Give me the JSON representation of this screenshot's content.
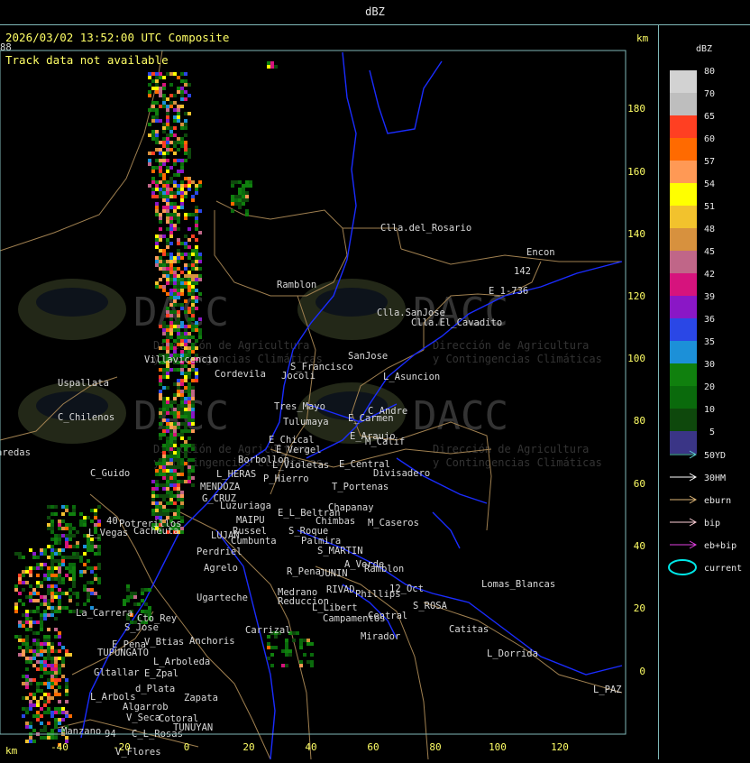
{
  "window": {
    "title": "dBZ"
  },
  "header": {
    "timestamp": "2026/03/02 13:52:00 UTC Composite",
    "status": "Track data not available",
    "unit_top": "km",
    "unit_bottom": "km"
  },
  "axes": {
    "x_ticks": [
      "-40",
      "-20",
      "0",
      "20",
      "40",
      "60",
      "80",
      "100",
      "120"
    ],
    "y_ticks": [
      "180",
      "160",
      "140",
      "120",
      "100",
      "80",
      "60",
      "40",
      "20",
      "0"
    ]
  },
  "watermarks": [
    {
      "logo": "DACC",
      "line1": "Dirección de Agricultura",
      "line2": "y Contingencias Climáticas"
    },
    {
      "logo": "DACC",
      "line1": "Dirección de Agricultura",
      "line2": "y Contingencias Climáticas"
    },
    {
      "logo": "DACC",
      "line1": "Dirección de Agricultura",
      "line2": "y Contingencias Climáticas"
    },
    {
      "logo": "DACC",
      "line1": "Dirección de Agricultura",
      "line2": "y Contingencias Climáticas"
    }
  ],
  "places": [
    "Clla.del_Rosario",
    "Encon",
    "142",
    "E_1-736",
    "Ramblon",
    "Clla.SanJose",
    "Clla.El_Cavadito",
    "S_Francisco",
    "SanJose",
    "Uspallata",
    "Villavicencio",
    "Cordevila",
    "L_Asuncion",
    "Jocoli",
    "Tres_Mayo",
    "E_Carmen",
    "C_Andre",
    "C_Chilenos",
    "Tulumaya",
    "E_Araujo",
    "M_Calif",
    "E_Chical",
    "E_Vergel",
    "Borbollon",
    "L_Violetas",
    "E_Central",
    "Divisadero",
    "aredas",
    "C_Guido",
    "L_HERAS",
    "P_Hierro",
    "T_Portenas",
    "MENDOZA",
    "G_CRUZ",
    "Luzuriaga",
    "E_L_Beltran",
    "Chapanay",
    "Potrerillos",
    "L_Vegas",
    "Cacheuta",
    "MAIPU",
    "Russel",
    "Chimbas",
    "M_Caseros",
    "LUJAN",
    "S_Roque",
    "Palmira",
    "Perdriel",
    "Cumbunta",
    "S_MARTIN",
    "Agrelo",
    "R_Pena",
    "JUNIN",
    "A_Verde",
    "Ramblon",
    "Ugarteche",
    "Medrano",
    "RIVAD",
    "Phillips",
    "12_Oct",
    "Lomas_Blancas",
    "Reduccion",
    "L_Libert",
    "S_ROSA",
    "La_Carrera",
    "Cto_Rey",
    "Campamentos",
    "Central",
    "S_Jose",
    "Carrizal",
    "Catitas",
    "E_Pena",
    "V_Btias",
    "Anchoris",
    "Mirador",
    "TUPUNGATO",
    "L_Dorrida",
    "L_Arboleda",
    "Gltallar",
    "E_Zpal",
    "d_Plata",
    "L_PAZ",
    "L_Arbols",
    "Zapata",
    "Algarrob",
    "V_Seca",
    "Cotoral",
    "TUNUYAN",
    "Manzano",
    "C_L_Rosas",
    "V_Flores",
    "94",
    "40",
    "88"
  ],
  "colorbar": {
    "title": "dBZ",
    "levels": [
      "80",
      "70",
      "65",
      "60",
      "57",
      "54",
      "51",
      "48",
      "45",
      "42",
      "39",
      "36",
      "35",
      "30",
      "20",
      "10",
      "5"
    ],
    "colors": [
      "#d2d2d2",
      "#bebebe",
      "#ff3f22",
      "#ff6a00",
      "#ff9955",
      "#ffff00",
      "#f2c22d",
      "#d7913e",
      "#c06688",
      "#d6137d",
      "#8a17c6",
      "#2a47e6",
      "#1c90d8",
      "#10800e",
      "#0a6a0c",
      "#0e480c",
      "#3a3586"
    ]
  },
  "tracks": [
    {
      "label": "50YD",
      "color": "#5fd0d0"
    },
    {
      "label": "30HM",
      "color": "#ffffff"
    },
    {
      "label": "eburn",
      "color": "#e0b878"
    },
    {
      "label": "bip",
      "color": "#ffd0d8"
    },
    {
      "label": "eb+bip",
      "color": "#e040e0"
    },
    {
      "label": "current",
      "color": "#00e8e8"
    }
  ],
  "palette": {
    "frame": "#7fb8b8",
    "tick": "#ffff66",
    "label": "#d8d8d8",
    "road": "#a08050",
    "river": "#1a2cff"
  }
}
